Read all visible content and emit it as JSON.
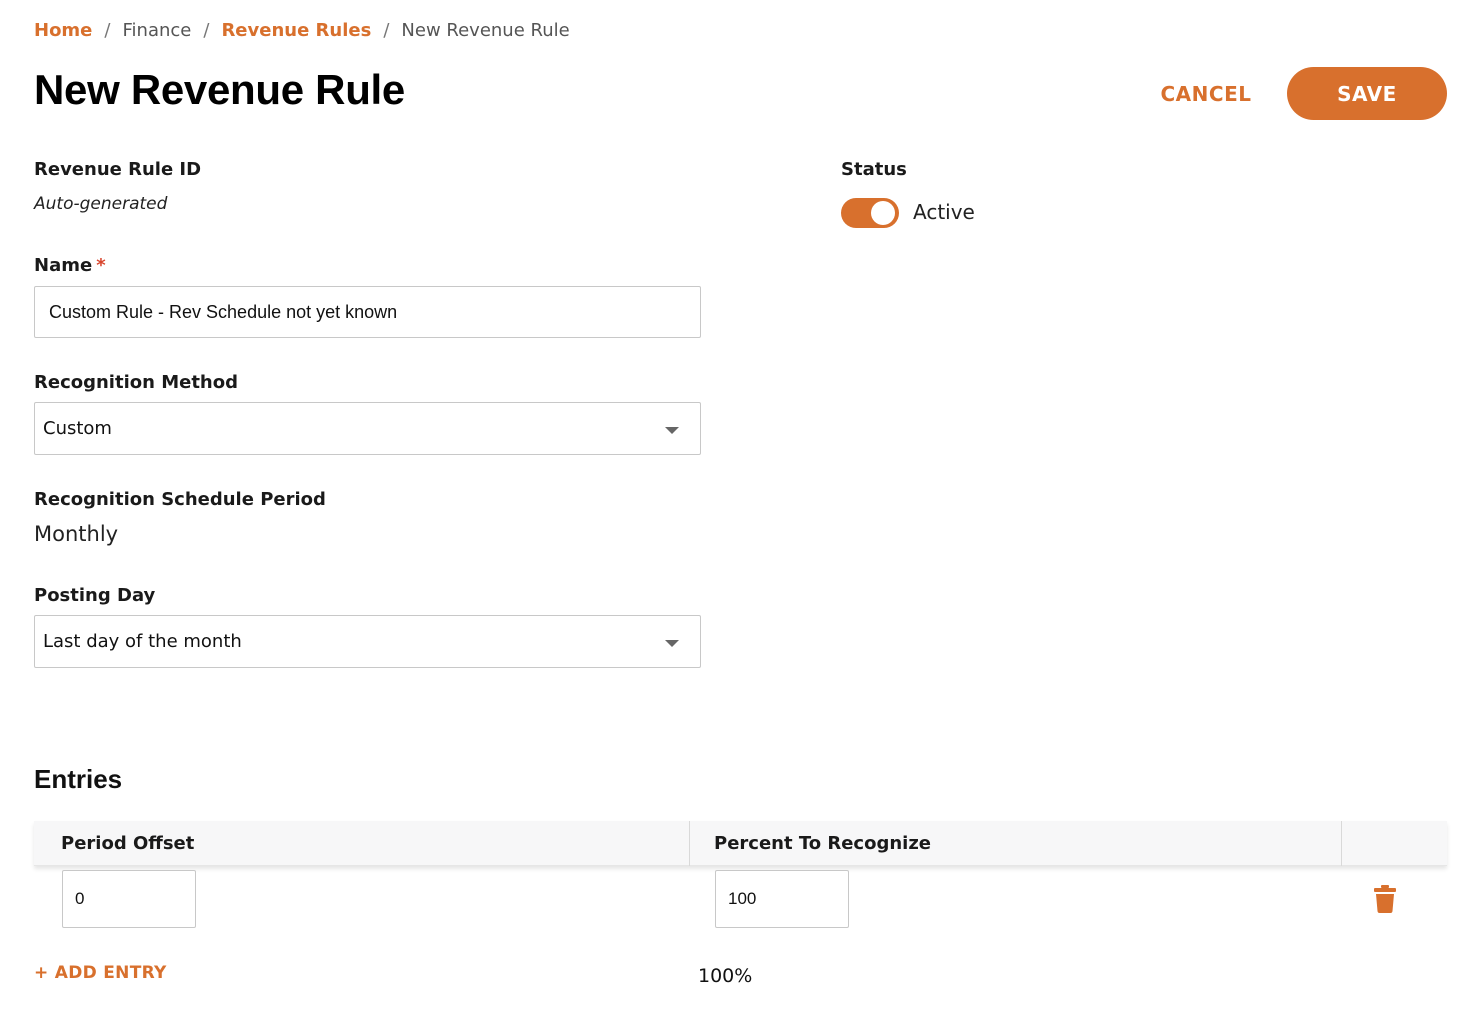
{
  "breadcrumb": {
    "items": [
      {
        "label": "Home",
        "link": true
      },
      {
        "label": "Finance",
        "link": false
      },
      {
        "label": "Revenue Rules",
        "link": true
      },
      {
        "label": "New Revenue Rule",
        "link": false
      }
    ],
    "separator": "/"
  },
  "header": {
    "title": "New Revenue Rule",
    "cancel_label": "CANCEL",
    "save_label": "SAVE"
  },
  "form": {
    "revenue_rule_id": {
      "label": "Revenue Rule ID",
      "value": "Auto-generated"
    },
    "name": {
      "label": "Name",
      "required_mark": "*",
      "value": "Custom Rule - Rev Schedule not yet known"
    },
    "recognition_method": {
      "label": "Recognition Method",
      "value": "Custom"
    },
    "recognition_schedule_period": {
      "label": "Recognition Schedule Period",
      "value": "Monthly"
    },
    "posting_day": {
      "label": "Posting Day",
      "value": "Last day of the month"
    },
    "status": {
      "label": "Status",
      "value": "Active",
      "on": true
    }
  },
  "entries": {
    "title": "Entries",
    "columns": [
      "Period Offset",
      "Percent To Recognize"
    ],
    "rows": [
      {
        "period_offset": "0",
        "percent": "100"
      }
    ],
    "add_label": "+ ADD ENTRY",
    "total": "100%"
  },
  "colors": {
    "accent": "#d8702d",
    "required": "#d8452d"
  },
  "icons": {
    "delete_row": "trash-icon",
    "dropdown": "chevron-down-icon"
  }
}
